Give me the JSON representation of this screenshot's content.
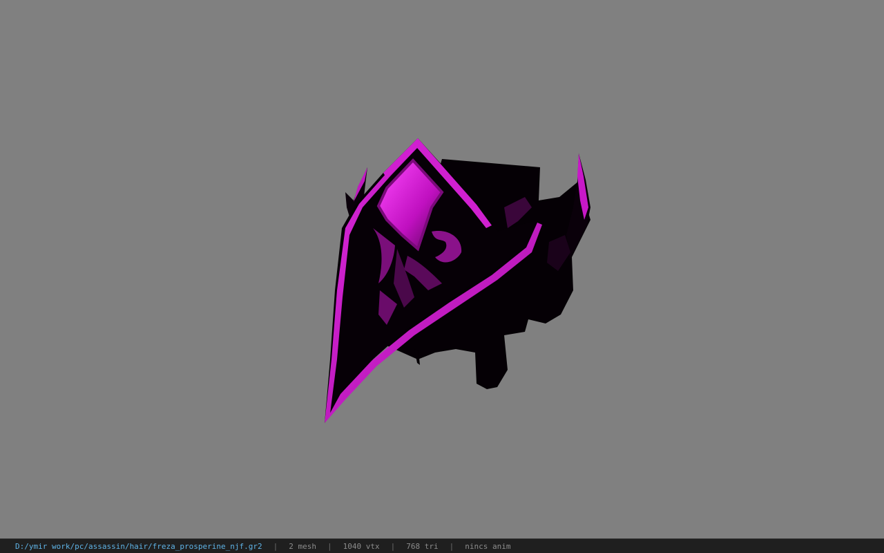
{
  "viewport": {
    "background_color": "#808080",
    "model": {
      "accent_color": "#d41ad4",
      "body_color": "#050005"
    }
  },
  "status_bar": {
    "file_path": "D:/ymir work/pc/assassin/hair/freza_prosperine_njf.gr2",
    "mesh_count": "2 mesh",
    "vertex_count": "1040 vtx",
    "triangle_count": "768 tri",
    "anim_status": "nincs anim",
    "separator": "|"
  }
}
